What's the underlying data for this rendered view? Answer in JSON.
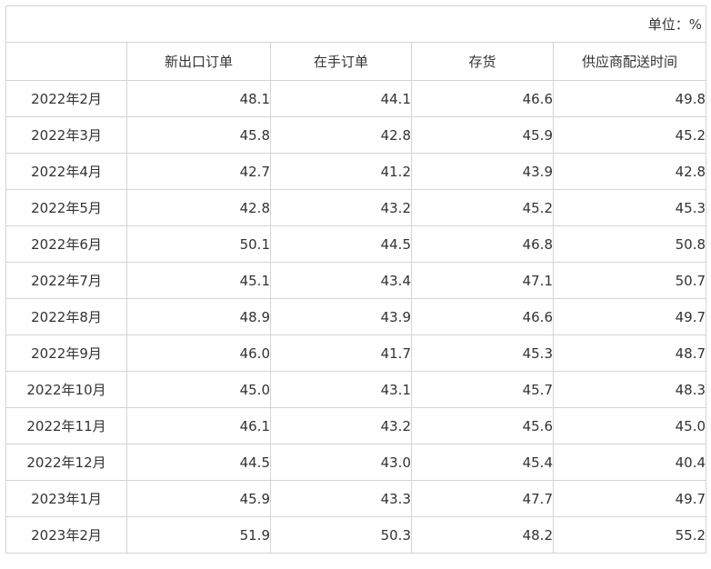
{
  "unit_label": "单位：%",
  "columns": [
    "",
    "新出口订单",
    "在手订单",
    "存货",
    "供应商配送时间"
  ],
  "rows": [
    {
      "month": "2022年2月",
      "values": [
        "48.1",
        "44.1",
        "46.6",
        "49.8"
      ]
    },
    {
      "month": "2022年3月",
      "values": [
        "45.8",
        "42.8",
        "45.9",
        "45.2"
      ]
    },
    {
      "month": "2022年4月",
      "values": [
        "42.7",
        "41.2",
        "43.9",
        "42.8"
      ]
    },
    {
      "month": "2022年5月",
      "values": [
        "42.8",
        "43.2",
        "45.2",
        "45.3"
      ]
    },
    {
      "month": "2022年6月",
      "values": [
        "50.1",
        "44.5",
        "46.8",
        "50.8"
      ]
    },
    {
      "month": "2022年7月",
      "values": [
        "45.1",
        "43.4",
        "47.1",
        "50.7"
      ]
    },
    {
      "month": "2022年8月",
      "values": [
        "48.9",
        "43.9",
        "46.6",
        "49.7"
      ]
    },
    {
      "month": "2022年9月",
      "values": [
        "46.0",
        "41.7",
        "45.3",
        "48.7"
      ]
    },
    {
      "month": "2022年10月",
      "values": [
        "45.0",
        "43.1",
        "45.7",
        "48.3"
      ]
    },
    {
      "month": "2022年11月",
      "values": [
        "46.1",
        "43.2",
        "45.6",
        "45.0"
      ]
    },
    {
      "month": "2022年12月",
      "values": [
        "44.5",
        "43.0",
        "45.4",
        "40.4"
      ]
    },
    {
      "month": "2023年1月",
      "values": [
        "45.9",
        "43.3",
        "47.7",
        "49.7"
      ]
    },
    {
      "month": "2023年2月",
      "values": [
        "51.9",
        "50.3",
        "48.2",
        "55.2"
      ]
    }
  ]
}
